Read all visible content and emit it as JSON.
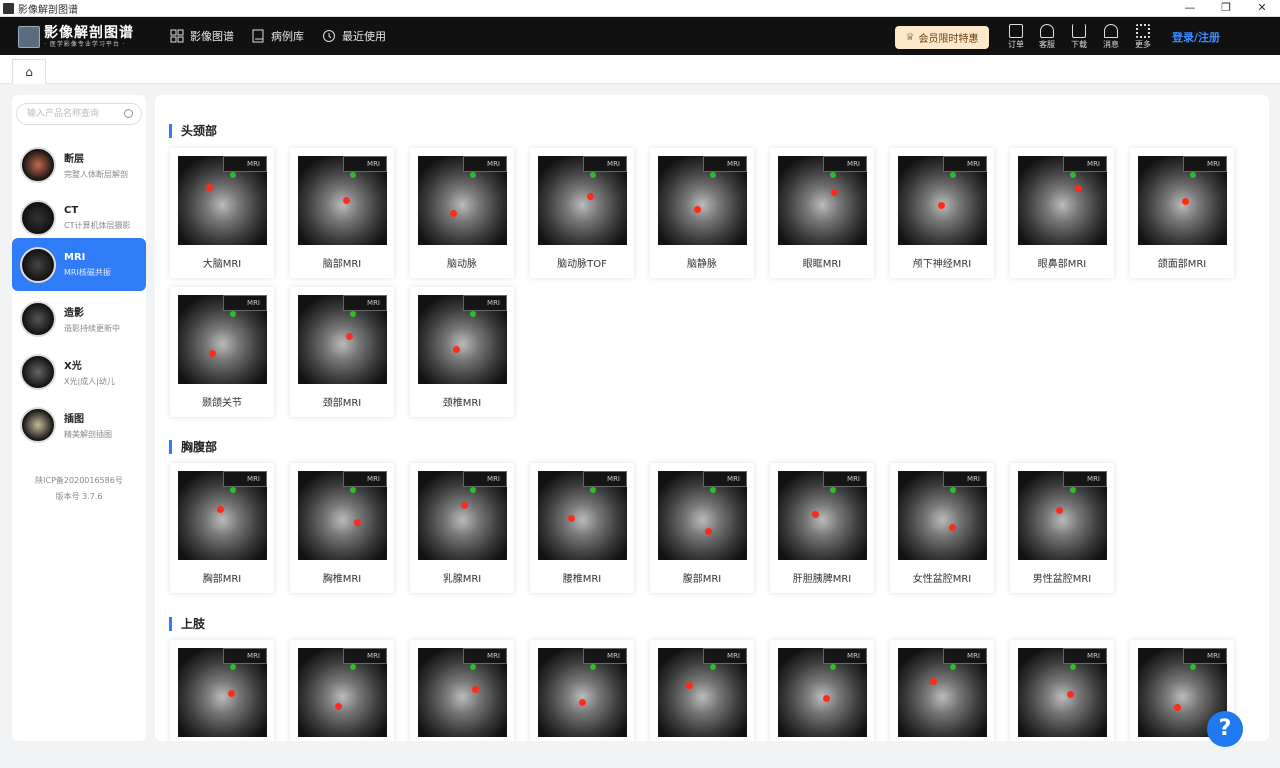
{
  "window": {
    "title": "影像解剖图谱",
    "controls": [
      "—",
      "❐",
      "✕"
    ]
  },
  "header": {
    "logo_title": "影像解剖图谱",
    "logo_subtitle": "· 医学影像专业学习平台 ·",
    "nav": [
      {
        "label": "影像图谱",
        "icon": "grid-icon"
      },
      {
        "label": "病例库",
        "icon": "book-icon"
      },
      {
        "label": "最近使用",
        "icon": "history-icon"
      }
    ],
    "vip_label": "会员限时特惠",
    "tools": [
      {
        "label": "订单",
        "icon": "order-icon"
      },
      {
        "label": "客服",
        "icon": "headset-icon"
      },
      {
        "label": "下载",
        "icon": "download-icon"
      },
      {
        "label": "消息",
        "icon": "bell-icon"
      },
      {
        "label": "更多",
        "icon": "apps-icon"
      }
    ],
    "login_label": "登录/注册"
  },
  "sidebar": {
    "search_placeholder": "输入产品名称查询",
    "categories": [
      {
        "title": "断层",
        "subtitle": "完整人体断层解剖"
      },
      {
        "title": "CT",
        "subtitle": "CT计算机体层摄影"
      },
      {
        "title": "MRI",
        "subtitle": "MRI核磁共振"
      },
      {
        "title": "造影",
        "subtitle": "造影持续更新中"
      },
      {
        "title": "X光",
        "subtitle": "X光|成人|幼儿"
      },
      {
        "title": "插图",
        "subtitle": "精美解剖插图"
      }
    ],
    "active_index": 2,
    "icp": "陕ICP备2020016586号",
    "version": "版本号 3.7.6"
  },
  "sections": [
    {
      "title": "头颈部",
      "cards": [
        "大脑MRI",
        "脑部MRI",
        "脑动脉",
        "脑动脉TOF",
        "脑静脉",
        "眼眶MRI",
        "颅下神经MRI",
        "眼鼻部MRI",
        "颌面部MRI",
        "颞颌关节",
        "颈部MRI",
        "颈椎MRI"
      ]
    },
    {
      "title": "胸腹部",
      "cards": [
        "胸部MRI",
        "胸椎MRI",
        "乳腺MRI",
        "腰椎MRI",
        "腹部MRI",
        "肝胆胰脾MRI",
        "女性盆腔MRI",
        "男性盆腔MRI"
      ]
    },
    {
      "title": "上肢",
      "cards": [
        "",
        "",
        "",
        "",
        "",
        "",
        "",
        "",
        ""
      ]
    }
  ],
  "card_tag": "MRI",
  "help_label": "?"
}
